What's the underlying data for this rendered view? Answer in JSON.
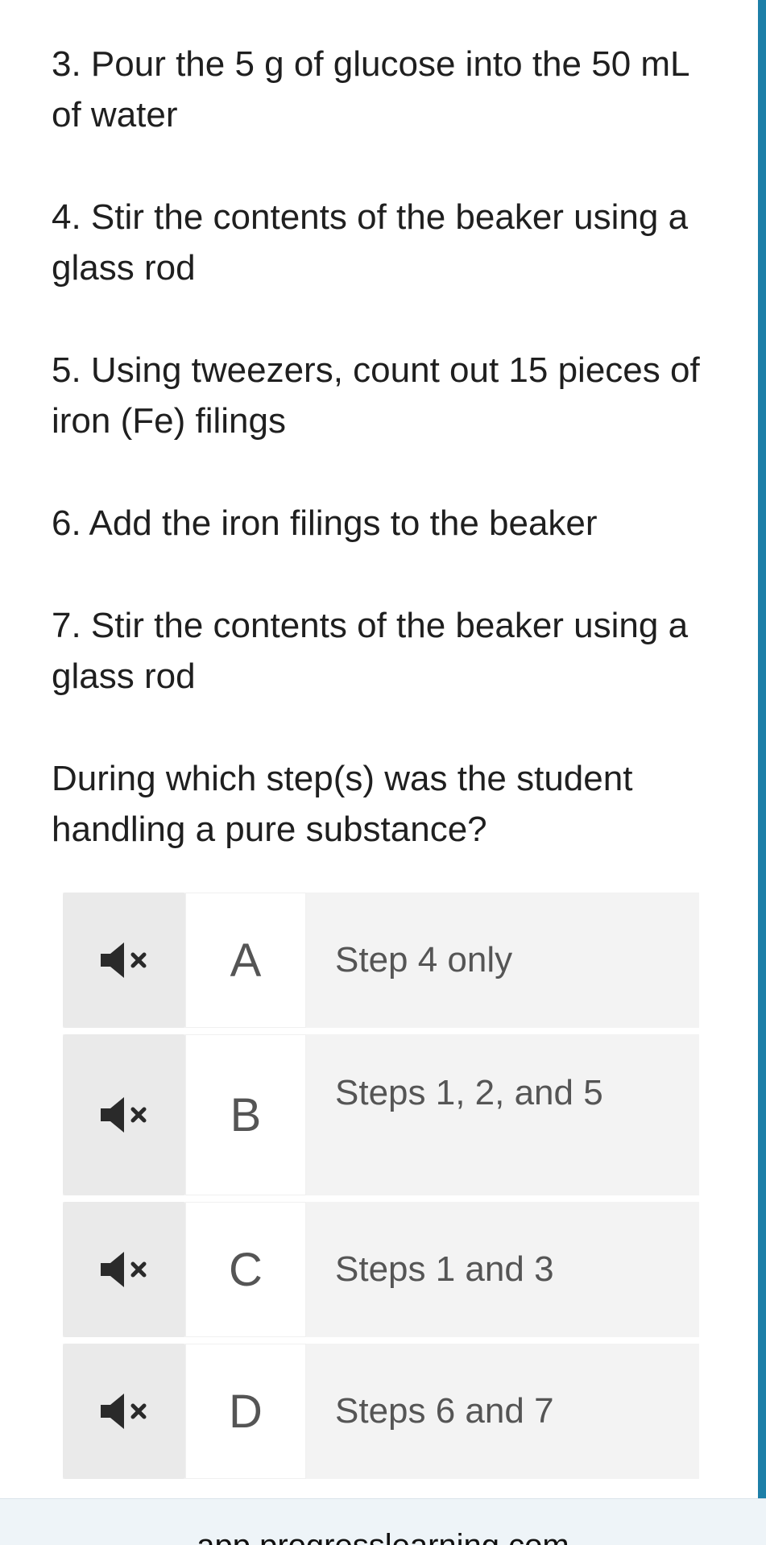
{
  "steps": [
    "3. Pour the 5 g of glucose into the 50 mL of water",
    "4. Stir the contents of the beaker using a glass rod",
    "5. Using tweezers, count out 15 pieces of iron (Fe) filings",
    "6. Add the iron filings to the beaker",
    "7. Stir the contents of the beaker using a glass rod"
  ],
  "question": "During which step(s) was the student handling a pure substance?",
  "answers": [
    {
      "letter": "A",
      "text": "Step  4 only",
      "audio_icon": "speaker-muted-icon"
    },
    {
      "letter": "B",
      "text": "Steps 1, 2, and 5",
      "audio_icon": "speaker-muted-icon"
    },
    {
      "letter": "C",
      "text": "Steps 1 and 3",
      "audio_icon": "speaker-muted-icon"
    },
    {
      "letter": "D",
      "text": "Steps 6 and 7",
      "audio_icon": "speaker-muted-icon"
    }
  ],
  "footer": {
    "url": "app.progresslearning.com"
  },
  "colors": {
    "accent": "#1d7fa8",
    "answer_bg": "#f3f3f3",
    "audio_bg": "#eaeaea",
    "text": "#1f1f1f",
    "answer_text": "#555555"
  }
}
